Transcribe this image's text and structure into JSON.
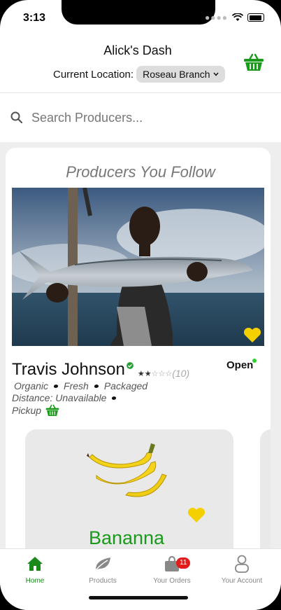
{
  "status_bar": {
    "time": "3:13"
  },
  "header": {
    "title": "Alick's Dash",
    "location_label": "Current Location:",
    "location_value": "Roseau Branch"
  },
  "search": {
    "placeholder": "Search Producers..."
  },
  "section": {
    "title": "Producers You Follow"
  },
  "producer": {
    "name": "Travis Johnson",
    "status": "Open",
    "rating_count": "(10)",
    "rating": 2,
    "rating_max": 5,
    "tags": [
      "Organic",
      "Fresh",
      "Packaged"
    ],
    "distance": "Distance: Unavailable",
    "delivery": "Pickup"
  },
  "product": {
    "name": "Bananna"
  },
  "tabs": [
    {
      "label": "Home",
      "icon": "home-icon",
      "active": true
    },
    {
      "label": "Products",
      "icon": "leaf-icon",
      "active": false
    },
    {
      "label": "Your Orders",
      "icon": "shopping-bag-icon",
      "active": false,
      "badge": "11"
    },
    {
      "label": "Your Account",
      "icon": "user-icon",
      "active": false
    }
  ],
  "colors": {
    "accent_green": "#1a9a1a",
    "heart_yellow": "#f5d000",
    "badge_red": "#e41b1b",
    "open_dot": "#2fd02f"
  }
}
